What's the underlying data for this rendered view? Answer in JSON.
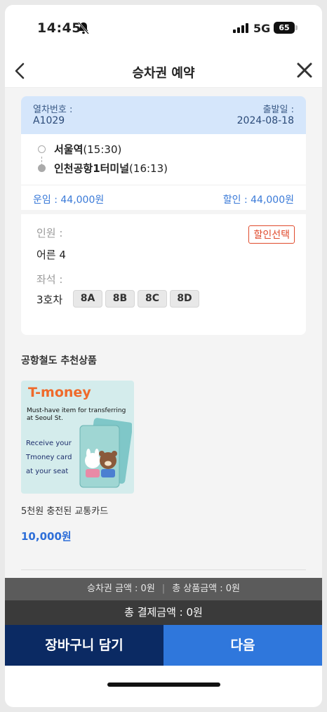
{
  "status_bar": {
    "time": "14:45",
    "network": "5G",
    "battery": "65"
  },
  "header": {
    "title": "승차권 예약"
  },
  "train": {
    "number_label": "열차번호 :",
    "number": "A1029",
    "date_label": "출발일 :",
    "date": "2024-08-18",
    "departure": {
      "station": "서울역",
      "time": "(15:30)"
    },
    "arrival": {
      "station": "인천공항1터미널",
      "time": "(16:13)"
    },
    "fare_label": "운임 : 44,000원",
    "discount_label": "할인 : 44,000원"
  },
  "passenger": {
    "people_label": "인원 :",
    "people_value": "어른 4",
    "discount_button": "할인선택",
    "seat_label": "좌석 :",
    "car": "3호차",
    "seats": [
      "8A",
      "8B",
      "8C",
      "8D"
    ]
  },
  "recommend": {
    "title": "공항철도 추천상품",
    "product": {
      "brand": "T-money",
      "tagline": "Must-have item for transferring at Seoul St.",
      "promo_line1": "Receive your",
      "promo_line2": "Tmoney card",
      "promo_line3": "at your seat",
      "name": "5천원 충전된 교통카드",
      "price": "10,000원"
    }
  },
  "summary": {
    "ticket_amount": "승차권 금액 : 0원",
    "product_amount": "총 상품금액 : 0원",
    "separator": "|",
    "total": "총 결제금액 : 0원"
  },
  "buttons": {
    "cart": "장바구니 담기",
    "next": "다음"
  },
  "colors": {
    "accent": "#2f77dc",
    "navy": "#0b2a63",
    "discount_red": "#e04a2c",
    "train_header_bg": "#d5e6fb"
  }
}
